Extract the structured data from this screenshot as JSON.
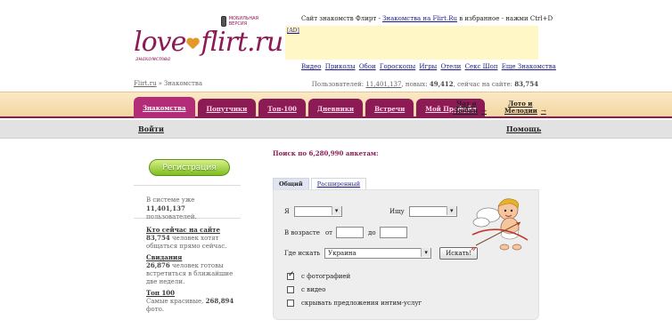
{
  "logo": {
    "main_a": "love",
    "main_b": "flirt.ru",
    "sub": "знакомства",
    "mobile_badge": "мобильная версия"
  },
  "top": {
    "line_a": "Сайт знакомств Флирт - ",
    "line_link": "Знакомства на Flirt.Ru",
    "line_b": " в избранное - нажми Ctrl+D",
    "ad_label": "[AD]",
    "links": [
      "Видео",
      "Приколы",
      "Обои",
      "Гороскопы",
      "Игры",
      "Отели",
      "Секс Шоп",
      "Еще Знакомства"
    ]
  },
  "breadcrumb": {
    "home": "Flirt.ru",
    "sep": "»",
    "current": "Знакомства"
  },
  "stats": {
    "users_label": "Пользователей:",
    "users": "11,401,137",
    "new_label": ", новых:",
    "new": "49,412",
    "online_label": ", сейчас на сайте:",
    "online": "83,754"
  },
  "nav": {
    "tabs": [
      "Знакомства",
      "Попутчики",
      "Топ-100",
      "Дневники",
      "Встречи",
      "Мой Профайл"
    ],
    "extra1": [
      "Чат о",
      "Любви"
    ],
    "extra2": [
      "Лото и",
      "Мелодии"
    ],
    "arrow": "→"
  },
  "login_bar": {
    "enter": "Войти",
    "help": "Помощь"
  },
  "left": {
    "register": "Регистрация",
    "in_system_a": "В системе уже ",
    "in_system_count": "11,401,137",
    "in_system_b": " пользователей.",
    "online_title": "Кто сейчас на сайте",
    "online_count": "83,754",
    "online_desc": " человек хотят общаться прямо сейчас.",
    "dates_title": "Свидания",
    "dates_count": "26,876",
    "dates_desc": " человек готовы встретиться в ближайшие две недели.",
    "top_title": "Топ 100",
    "top_desc": "Самые красивые, ",
    "top_count": "268,894",
    "top_desc_b": " фото."
  },
  "search": {
    "title": "Поиск по 6,280,990 анкетам:",
    "tab_general": "Общий",
    "tab_extended": "Расширенный",
    "i_label": "Я",
    "seek_label": "Ищу",
    "age_label": "В возрасте",
    "from_label": "от",
    "to_label": "до",
    "where_label": "Где искать",
    "where_value": "Украина",
    "submit": "Искать!",
    "opt_photo": "с фотографией",
    "opt_video": "с видео",
    "opt_hide": "скрывать предложения интим-услуг"
  }
}
